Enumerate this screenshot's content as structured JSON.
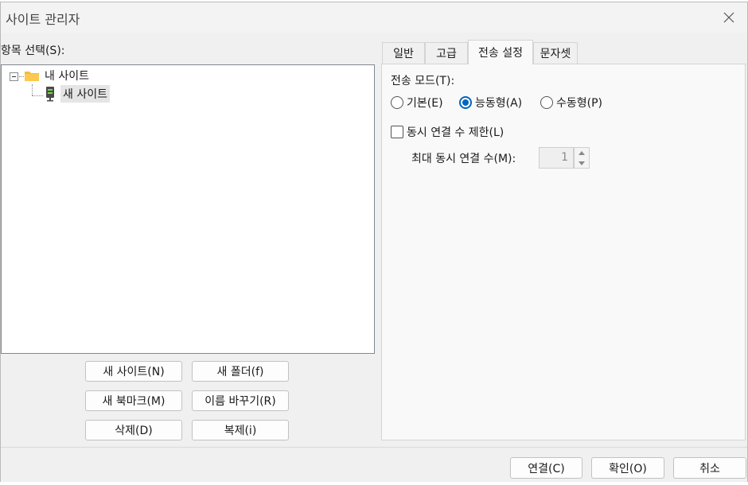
{
  "window": {
    "title": "사이트 관리자"
  },
  "left": {
    "select_label": "항목 선택(S):",
    "tree": {
      "root": {
        "label": "내 사이트"
      },
      "child": {
        "label": "새 사이트"
      }
    },
    "buttons": {
      "new_site": "새 사이트(N)",
      "new_folder": "새 폴더(f)",
      "new_bookmark": "새 북마크(M)",
      "rename": "이름 바꾸기(R)",
      "delete": "삭제(D)",
      "duplicate": "복제(i)"
    }
  },
  "tabs": [
    {
      "label": "일반"
    },
    {
      "label": "고급"
    },
    {
      "label": "전송 설정",
      "active": true
    },
    {
      "label": "문자셋"
    }
  ],
  "transfer": {
    "mode_label": "전송 모드(T):",
    "modes": [
      {
        "label": "기본(E)",
        "checked": false
      },
      {
        "label": "능동형(A)",
        "checked": true
      },
      {
        "label": "수동형(P)",
        "checked": false
      }
    ],
    "limit_checkbox": {
      "label": "동시 연결 수 제한(L)",
      "checked": false
    },
    "max_label": "최대 동시 연결 수(M):",
    "max_value": "1"
  },
  "footer": {
    "connect": "연결(C)",
    "ok": "확인(O)",
    "cancel": "취소"
  },
  "colors": {
    "accent": "#0067c0",
    "folder": "#f6b93b"
  }
}
